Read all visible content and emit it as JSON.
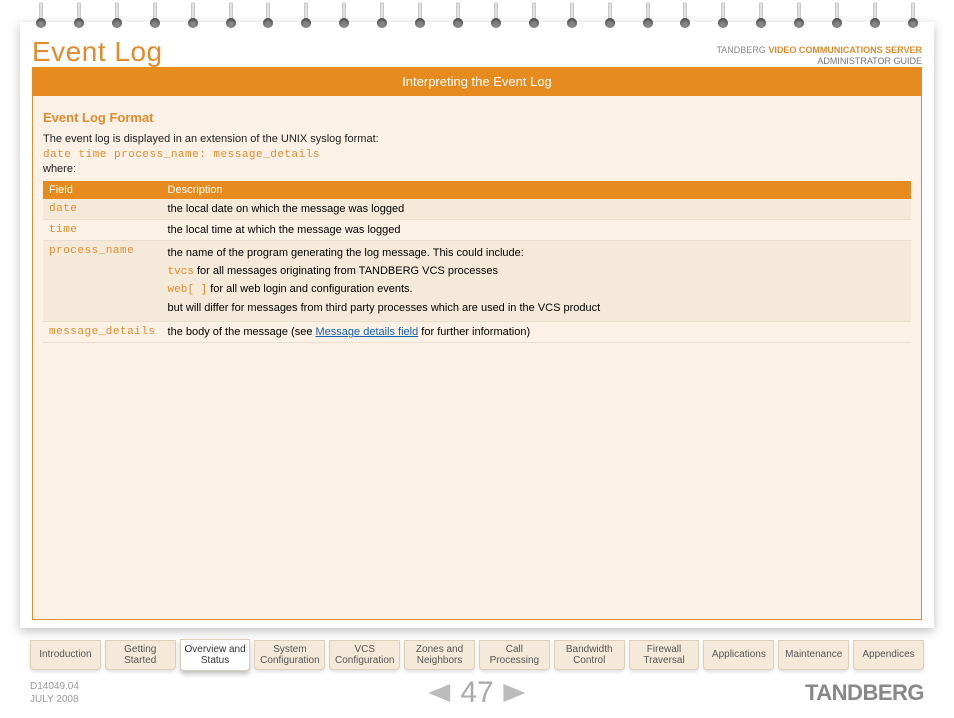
{
  "header": {
    "brand": "TANDBERG",
    "product": "VIDEO COMMUNICATIONS SERVER",
    "guide": "ADMINISTRATOR GUIDE",
    "page_title": "Event Log"
  },
  "banner": "Interpreting the Event Log",
  "section_title": "Event Log Format",
  "intro": "The event log is displayed in an extension of the UNIX syslog format:",
  "syntax": "date time process_name: message_details",
  "where": "where:",
  "table": {
    "headers": [
      "Field",
      "Description"
    ],
    "rows": [
      {
        "field": "date",
        "desc_plain": "the local date on which the message was logged"
      },
      {
        "field": "time",
        "desc_plain": "the local time at which the message was logged"
      },
      {
        "field": "process_name",
        "desc_lines": [
          {
            "pre": "the name of the program generating the log message. This could include:"
          },
          {
            "mono": "tvcs",
            "post": " for all messages originating from TANDBERG VCS processes"
          },
          {
            "mono": "web[ ]",
            "post": " for all web login and configuration events."
          },
          {
            "pre": "but will differ for messages from third party processes which are used in the VCS product"
          }
        ]
      },
      {
        "field": "message_details",
        "desc_link": {
          "pre": "the body of the message (see ",
          "link": "Message details field",
          "post": " for further information)"
        }
      }
    ]
  },
  "tabs": [
    "Introduction",
    "Getting Started",
    "Overview and Status",
    "System Configuration",
    "VCS Configuration",
    "Zones and Neighbors",
    "Call Processing",
    "Bandwidth Control",
    "Firewall Traversal",
    "Applications",
    "Maintenance",
    "Appendices"
  ],
  "active_tab_index": 2,
  "footer": {
    "docnum": "D14049.04",
    "date": "JULY 2008",
    "page": "47",
    "logo": "TANDBERG"
  }
}
